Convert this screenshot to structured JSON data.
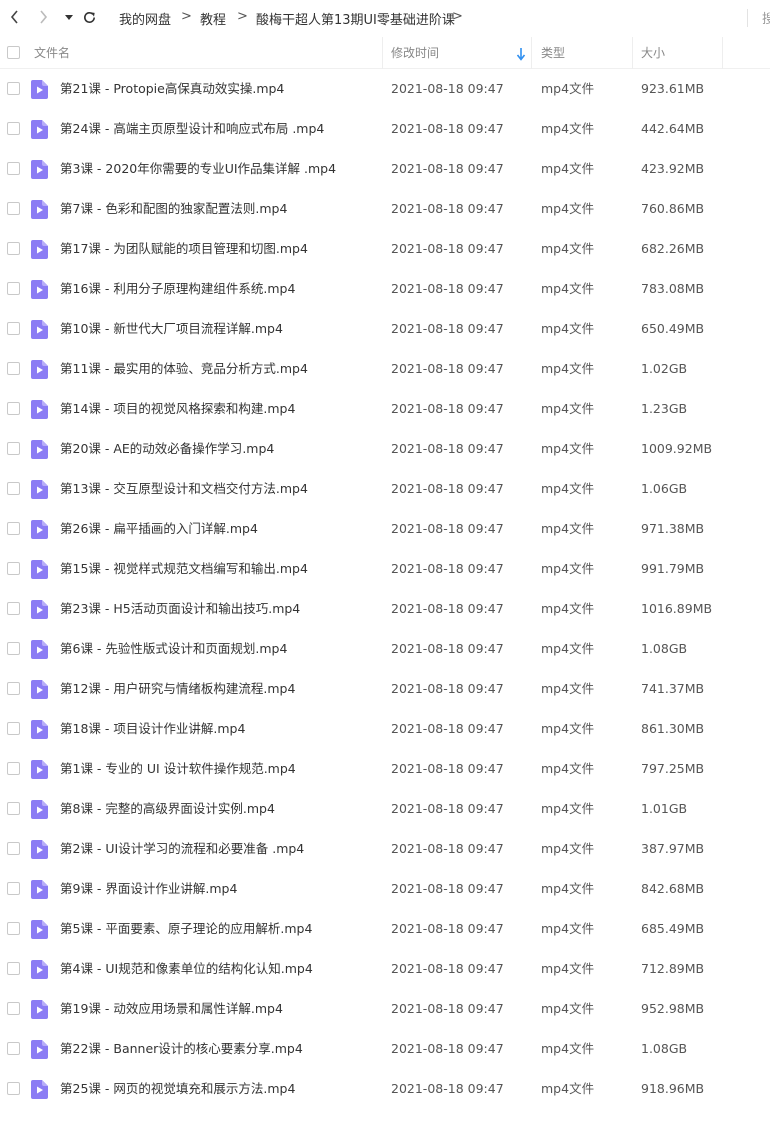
{
  "breadcrumb": {
    "items": [
      "我的网盘",
      "教程",
      "酸梅干超人第13期UI零基础进阶课"
    ],
    "separator": ">"
  },
  "search_hint": "搜",
  "columns": {
    "name": "文件名",
    "modified": "修改时间",
    "type": "类型",
    "size": "大小"
  },
  "colors": {
    "accent": "#2f8ff0",
    "file_icon": "#8b7cf4"
  },
  "files": [
    {
      "name": "第21课 - Protopie高保真动效实操.mp4",
      "modified": "2021-08-18 09:47",
      "type": "mp4文件",
      "size": "923.61MB"
    },
    {
      "name": "第24课 - 高端主页原型设计和响应式布局 .mp4",
      "modified": "2021-08-18 09:47",
      "type": "mp4文件",
      "size": "442.64MB"
    },
    {
      "name": "第3课 - 2020年你需要的专业UI作品集详解 .mp4",
      "modified": "2021-08-18 09:47",
      "type": "mp4文件",
      "size": "423.92MB"
    },
    {
      "name": "第7课 - 色彩和配图的独家配置法则.mp4",
      "modified": "2021-08-18 09:47",
      "type": "mp4文件",
      "size": "760.86MB"
    },
    {
      "name": "第17课 - 为团队赋能的项目管理和切图.mp4",
      "modified": "2021-08-18 09:47",
      "type": "mp4文件",
      "size": "682.26MB"
    },
    {
      "name": "第16课 - 利用分子原理构建组件系统.mp4",
      "modified": "2021-08-18 09:47",
      "type": "mp4文件",
      "size": "783.08MB"
    },
    {
      "name": "第10课 - 新世代大厂项目流程详解.mp4",
      "modified": "2021-08-18 09:47",
      "type": "mp4文件",
      "size": "650.49MB"
    },
    {
      "name": "第11课 - 最实用的体验、竞品分析方式.mp4",
      "modified": "2021-08-18 09:47",
      "type": "mp4文件",
      "size": "1.02GB"
    },
    {
      "name": "第14课 - 项目的视觉风格探索和构建.mp4",
      "modified": "2021-08-18 09:47",
      "type": "mp4文件",
      "size": "1.23GB"
    },
    {
      "name": "第20课 - AE的动效必备操作学习.mp4",
      "modified": "2021-08-18 09:47",
      "type": "mp4文件",
      "size": "1009.92MB"
    },
    {
      "name": "第13课 - 交互原型设计和文档交付方法.mp4",
      "modified": "2021-08-18 09:47",
      "type": "mp4文件",
      "size": "1.06GB"
    },
    {
      "name": "第26课 - 扁平插画的入门详解.mp4",
      "modified": "2021-08-18 09:47",
      "type": "mp4文件",
      "size": "971.38MB"
    },
    {
      "name": "第15课 - 视觉样式规范文档编写和输出.mp4",
      "modified": "2021-08-18 09:47",
      "type": "mp4文件",
      "size": "991.79MB"
    },
    {
      "name": "第23课 - H5活动页面设计和输出技巧.mp4",
      "modified": "2021-08-18 09:47",
      "type": "mp4文件",
      "size": "1016.89MB"
    },
    {
      "name": "第6课 - 先验性版式设计和页面规划.mp4",
      "modified": "2021-08-18 09:47",
      "type": "mp4文件",
      "size": "1.08GB"
    },
    {
      "name": "第12课 - 用户研究与情绪板构建流程.mp4",
      "modified": "2021-08-18 09:47",
      "type": "mp4文件",
      "size": "741.37MB"
    },
    {
      "name": "第18课 - 项目设计作业讲解.mp4",
      "modified": "2021-08-18 09:47",
      "type": "mp4文件",
      "size": "861.30MB"
    },
    {
      "name": "第1课 - 专业的 UI 设计软件操作规范.mp4",
      "modified": "2021-08-18 09:47",
      "type": "mp4文件",
      "size": "797.25MB"
    },
    {
      "name": "第8课 - 完整的高级界面设计实例.mp4",
      "modified": "2021-08-18 09:47",
      "type": "mp4文件",
      "size": "1.01GB"
    },
    {
      "name": "第2课 - UI设计学习的流程和必要准备 .mp4",
      "modified": "2021-08-18 09:47",
      "type": "mp4文件",
      "size": "387.97MB"
    },
    {
      "name": "第9课 - 界面设计作业讲解.mp4",
      "modified": "2021-08-18 09:47",
      "type": "mp4文件",
      "size": "842.68MB"
    },
    {
      "name": "第5课 - 平面要素、原子理论的应用解析.mp4",
      "modified": "2021-08-18 09:47",
      "type": "mp4文件",
      "size": "685.49MB"
    },
    {
      "name": "第4课 - UI规范和像素单位的结构化认知.mp4",
      "modified": "2021-08-18 09:47",
      "type": "mp4文件",
      "size": "712.89MB"
    },
    {
      "name": "第19课 - 动效应用场景和属性详解.mp4",
      "modified": "2021-08-18 09:47",
      "type": "mp4文件",
      "size": "952.98MB"
    },
    {
      "name": "第22课 - Banner设计的核心要素分享.mp4",
      "modified": "2021-08-18 09:47",
      "type": "mp4文件",
      "size": "1.08GB"
    },
    {
      "name": "第25课 - 网页的视觉填充和展示方法.mp4",
      "modified": "2021-08-18 09:47",
      "type": "mp4文件",
      "size": "918.96MB"
    }
  ]
}
